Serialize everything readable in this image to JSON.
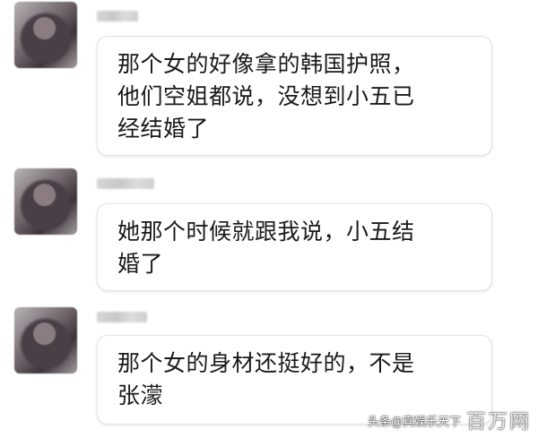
{
  "messages": [
    {
      "lines": [
        "那个女的好像拿的韩国护照，",
        "他们空姐都说，没想到小五已",
        "经结婚了"
      ]
    },
    {
      "lines": [
        "她那个时候就跟我说，小五结",
        "婚了"
      ]
    },
    {
      "lines": [
        "那个女的身材还挺好的，不是",
        "张濛"
      ]
    }
  ],
  "watermark": {
    "source": "头条@宾娱乐天下",
    "logo": "百万网"
  }
}
